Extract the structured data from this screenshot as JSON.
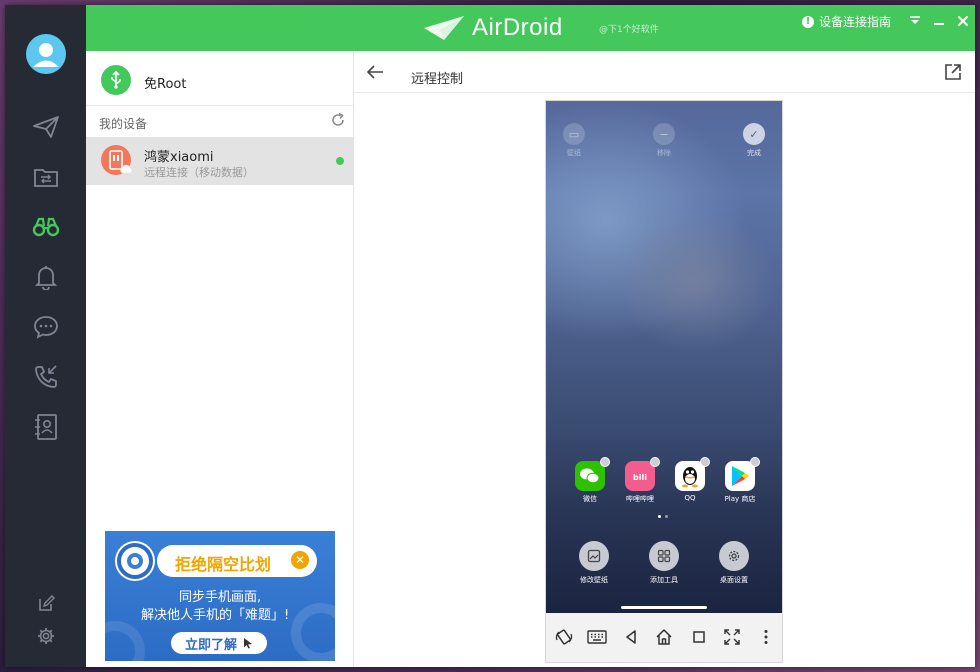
{
  "app": {
    "logo_text": "AirDroid",
    "watermark": "@下1个好软件",
    "guide_label": "设备连接指南",
    "accent": "#44c85c",
    "rail_bg": "#262a35"
  },
  "rail": {
    "items": [
      {
        "name": "send",
        "icon": "send-icon"
      },
      {
        "name": "files",
        "icon": "folder-transfer-icon"
      },
      {
        "name": "remote",
        "icon": "binoculars-icon",
        "active": true
      },
      {
        "name": "notifications",
        "icon": "bell-icon"
      },
      {
        "name": "messages",
        "icon": "chat-icon"
      },
      {
        "name": "calls",
        "icon": "phone-icon"
      },
      {
        "name": "contacts",
        "icon": "contacts-icon"
      }
    ],
    "bottom": [
      {
        "name": "edit",
        "icon": "edit-icon"
      },
      {
        "name": "settings",
        "icon": "gear-icon"
      }
    ]
  },
  "devices": {
    "no_root_label": "免Root",
    "section_title": "我的设备",
    "items": [
      {
        "name": "鸿蒙xiaomi",
        "status": "远程连接（移动数据）",
        "online": true
      }
    ]
  },
  "ad": {
    "title": "拒绝隔空比划",
    "line1": "同步手机画面,",
    "line2": "解决他人手机的「难题」!",
    "button": "立即了解"
  },
  "content": {
    "title": "远程控制"
  },
  "phone": {
    "top_ops": [
      {
        "label": "壁纸",
        "icon": "wallpaper-icon"
      },
      {
        "label": "移除",
        "icon": "minus-icon"
      },
      {
        "label": "完成",
        "icon": "check-icon",
        "done": true
      }
    ],
    "apps": [
      {
        "label": "微信",
        "icon": "wechat-icon",
        "color": "#2dc100"
      },
      {
        "label": "哔哩哔哩",
        "icon": "bilibili-icon",
        "color": "#f25d8e"
      },
      {
        "label": "QQ",
        "icon": "qq-icon",
        "color": "#ffffff"
      },
      {
        "label": "Play 商店",
        "icon": "play-store-icon",
        "color": "#ffffff"
      }
    ],
    "bottom_ops": [
      {
        "label": "修改壁纸",
        "icon": "wallpaper-icon"
      },
      {
        "label": "添加工具",
        "icon": "widgets-icon"
      },
      {
        "label": "桌面设置",
        "icon": "gear-icon"
      }
    ],
    "toolbar": [
      {
        "name": "rotate",
        "icon": "rotate-icon"
      },
      {
        "name": "keyboard",
        "icon": "keyboard-icon"
      },
      {
        "name": "back",
        "icon": "triangle-back-icon"
      },
      {
        "name": "home",
        "icon": "home-icon"
      },
      {
        "name": "recents",
        "icon": "square-icon"
      },
      {
        "name": "fullscreen",
        "icon": "fullscreen-icon"
      },
      {
        "name": "more",
        "icon": "more-vertical-icon"
      }
    ]
  }
}
